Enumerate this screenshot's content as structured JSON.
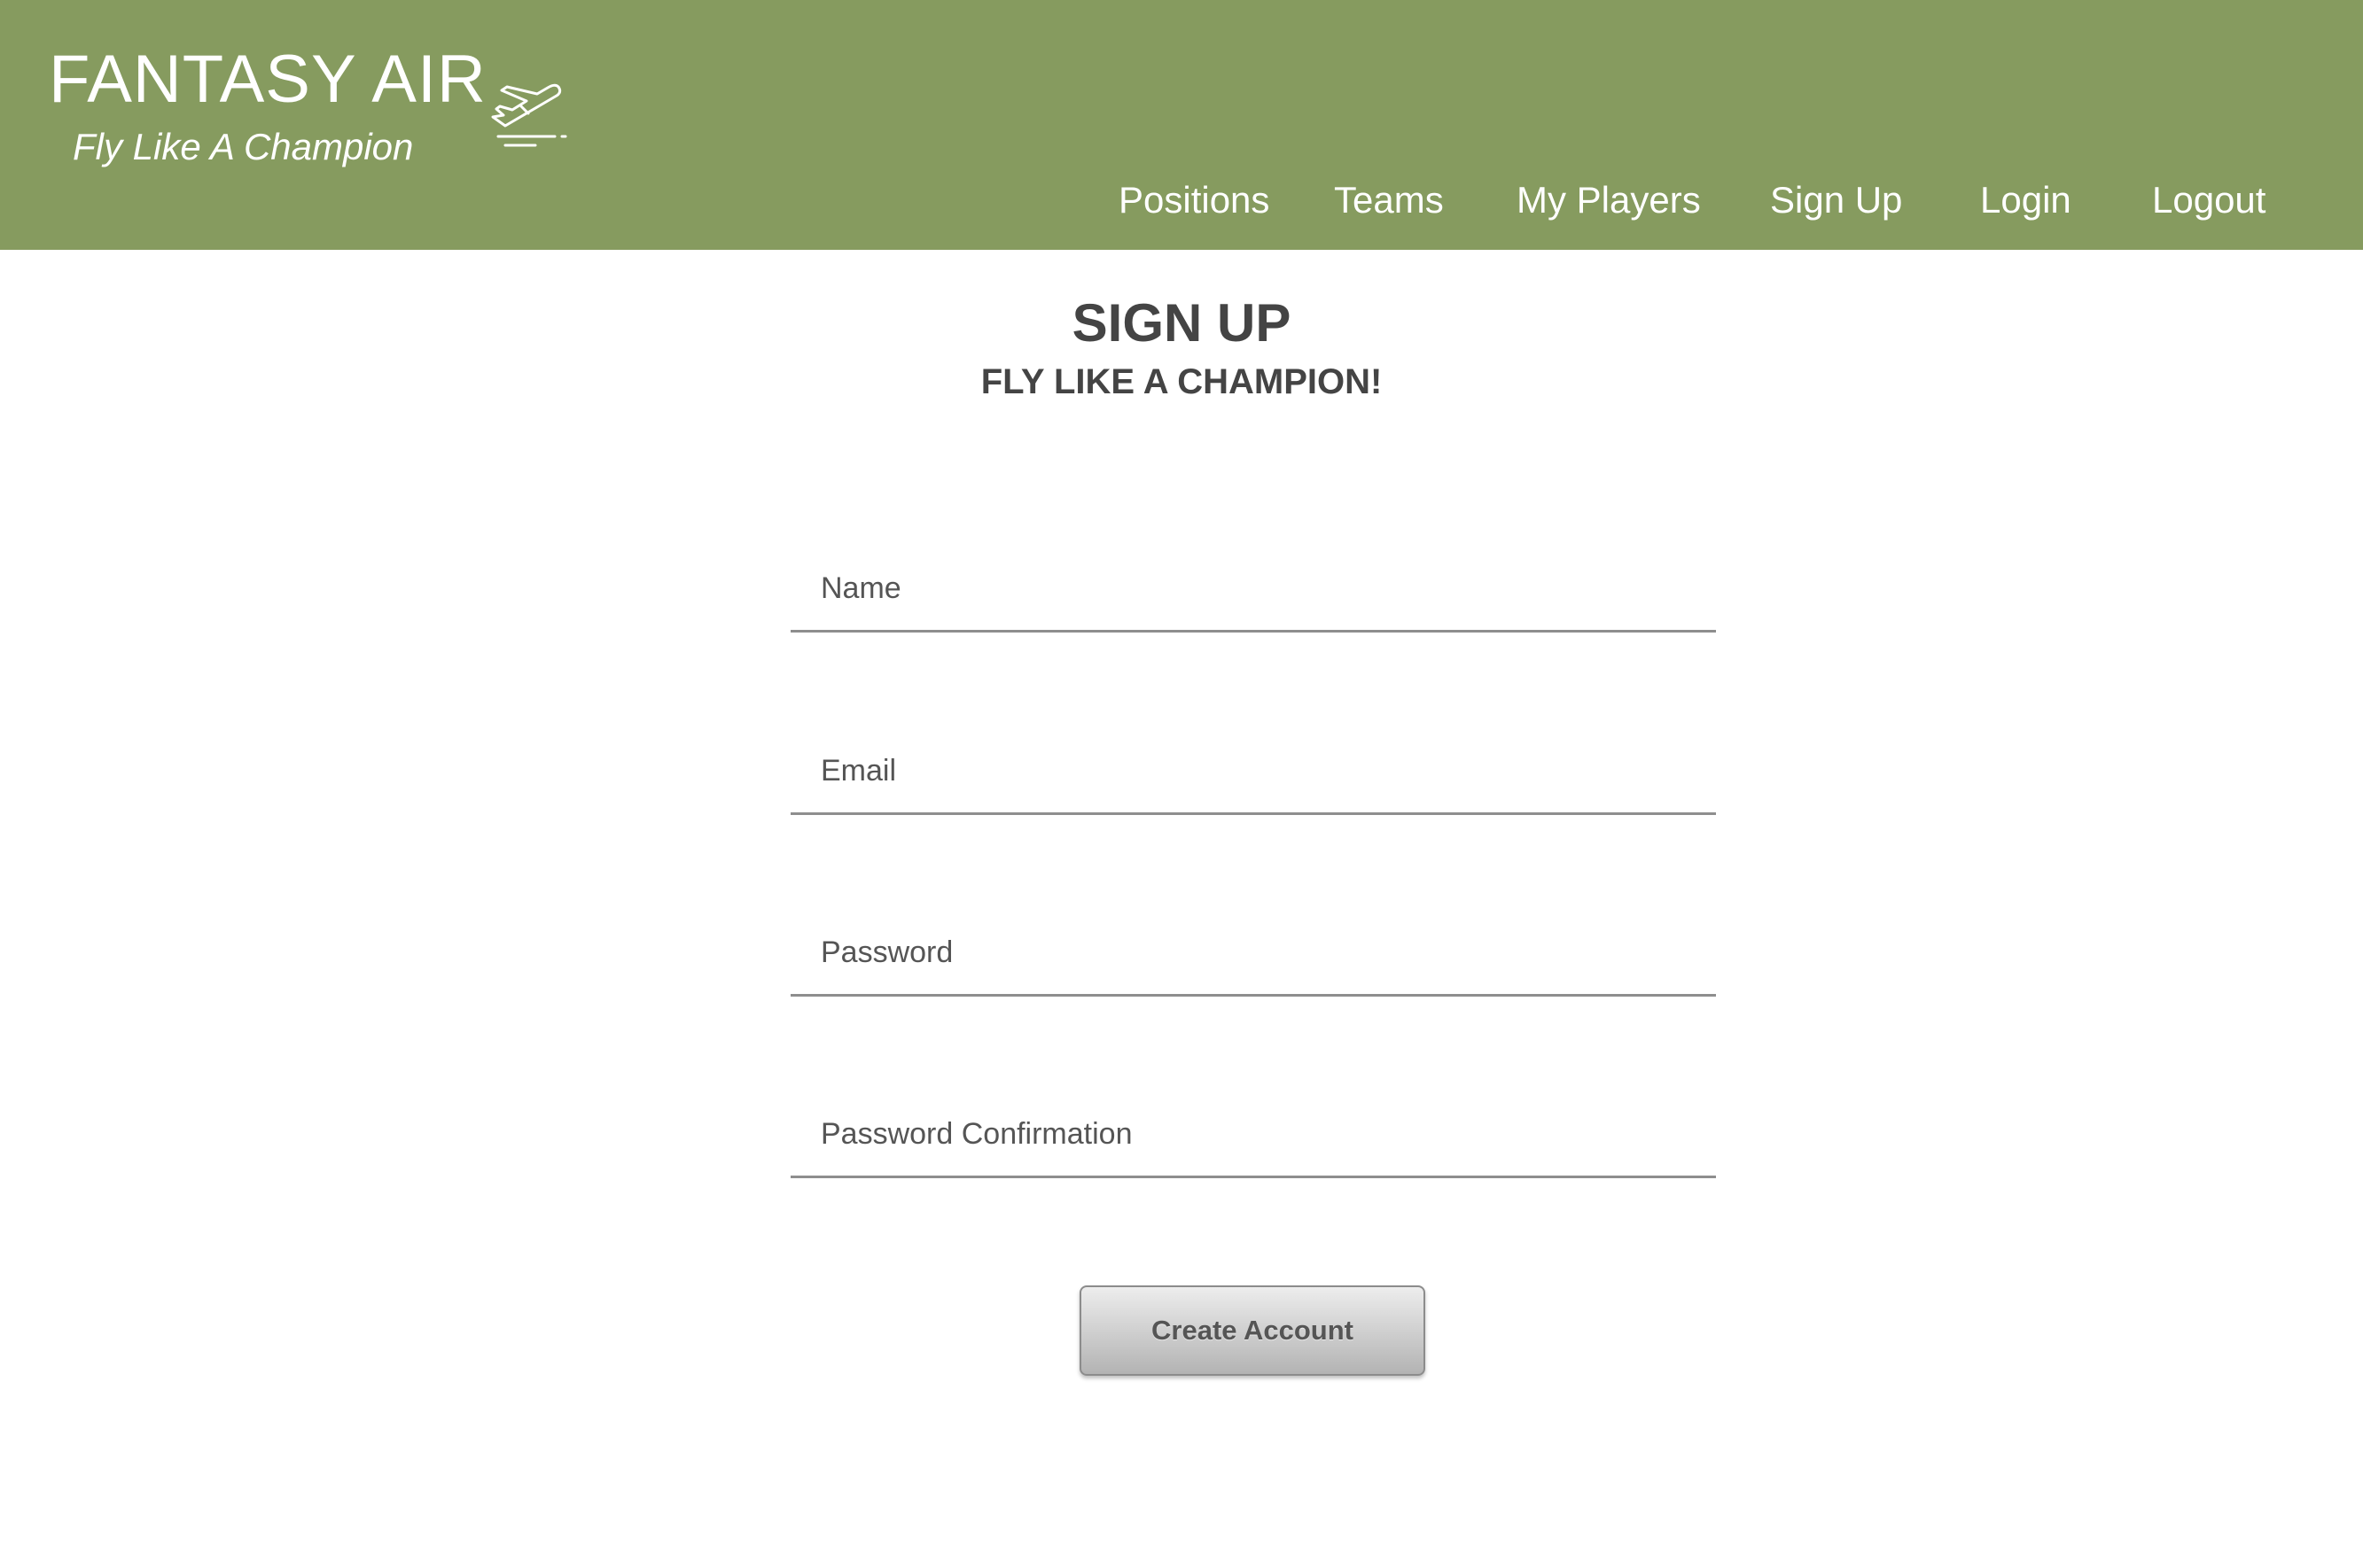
{
  "brand": {
    "title": "FANTASY AIR",
    "tagline": "Fly Like A Champion",
    "logo_icon": "plane-takeoff-icon"
  },
  "nav": {
    "items": [
      {
        "label": "Positions"
      },
      {
        "label": "Teams"
      },
      {
        "label": "My Players"
      },
      {
        "label": "Sign Up"
      },
      {
        "label": "Login"
      },
      {
        "label": "Logout"
      }
    ]
  },
  "main": {
    "heading": "SIGN UP",
    "subheading": "FLY LIKE A CHAMPION!",
    "form": {
      "name_placeholder": "Name",
      "email_placeholder": "Email",
      "password_placeholder": "Password",
      "password_confirmation_placeholder": "Password Confirmation",
      "submit_label": "Create Account"
    }
  },
  "colors": {
    "header_bg": "#869b5f",
    "header_text": "#ffffff",
    "heading_text": "#444444",
    "field_underline": "#8e8e8e"
  }
}
